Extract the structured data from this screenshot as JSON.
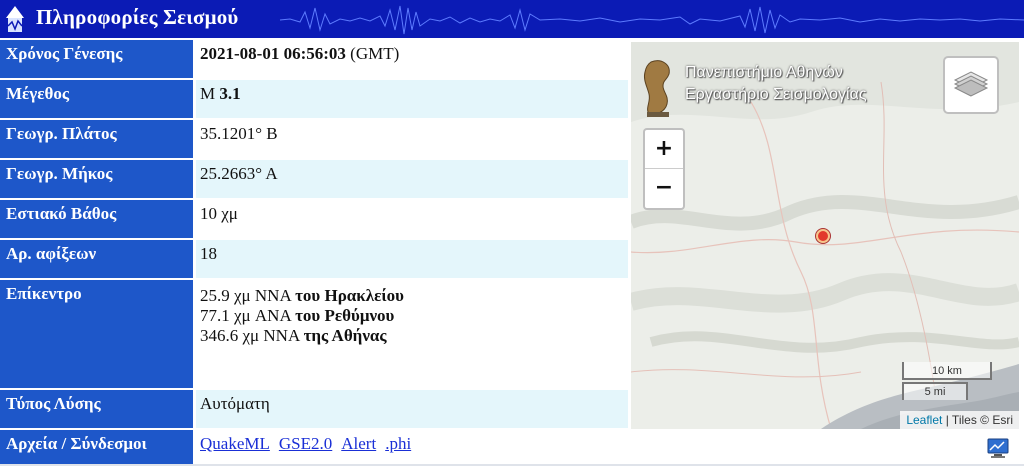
{
  "header": {
    "title": "Πληροφορίες Σεισμού"
  },
  "rows": [
    {
      "label": "Χρόνος Γένεσης",
      "value_bold": "2021-08-01 06:56:03",
      "value_rest": " (GMT)"
    },
    {
      "label": "Μέγεθος",
      "value_pre": "M ",
      "value_bold": "3.1"
    },
    {
      "label": "Γεωγρ. Πλάτος",
      "value": "35.1201° Β"
    },
    {
      "label": "Γεωγρ. Μήκος",
      "value": "25.2663° Α"
    },
    {
      "label": "Εστιακό Βάθος",
      "value": "10 χμ"
    },
    {
      "label": "Αρ. αφίξεων",
      "value": "18"
    },
    {
      "label": "Επίκεντρο",
      "lines": [
        {
          "pre": "25.9 χμ NNA ",
          "bold": "του Ηρακλείου"
        },
        {
          "pre": "77.1 χμ ANA ",
          "bold": "του Ρεθύμνου"
        },
        {
          "pre": "346.6 χμ NNA ",
          "bold": "της Αθήνας"
        }
      ]
    },
    {
      "label": "Τύπος Λύσης",
      "value": "Αυτόματη"
    },
    {
      "label": "Αρχεία / Σύνδεσμοι",
      "links": [
        "QuakeML",
        "GSE2.0",
        "Alert",
        ".phi"
      ]
    }
  ],
  "map": {
    "logo_line1": "Πανεπιστήμιο Αθηνών",
    "logo_line2": "Εργαστήριο Σεισμολογίας",
    "zoom_in": "+",
    "zoom_out": "−",
    "scale_km": "10 km",
    "scale_mi": "5 mi",
    "attribution_leaflet": "Leaflet",
    "attribution_rest": " | Tiles © Esri"
  },
  "colors": {
    "header_bg": "#0b1bb5",
    "label_bg": "#1e57c9",
    "alt_row_bg": "#e4f6fb",
    "link": "#1a2fd6",
    "marker": "#e2382b"
  }
}
